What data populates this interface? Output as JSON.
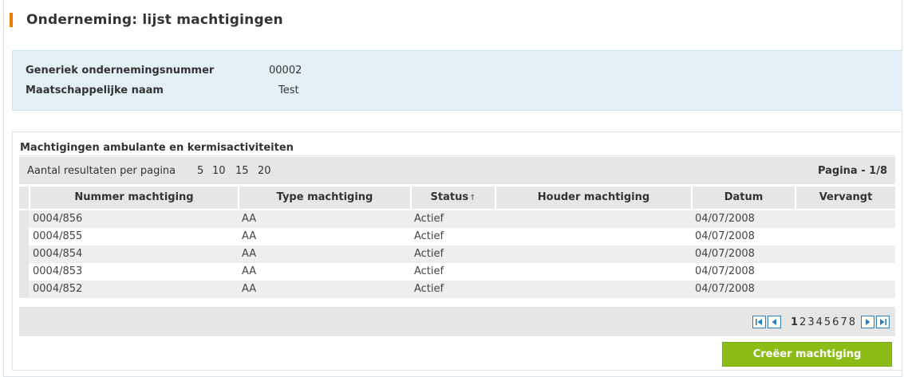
{
  "page": {
    "title": "Onderneming: lijst machtigingen"
  },
  "company": {
    "number_label": "Generiek ondernemingsnummer",
    "number_value": "00002",
    "name_label": "Maatschappelijke naam",
    "name_value": "Test"
  },
  "list": {
    "section_title": "Machtigingen ambulante en kermisactiviteiten",
    "per_page_label": "Aantal resultaten per pagina",
    "per_page_options": [
      "5",
      "10",
      "15",
      "20"
    ],
    "page_indicator": "Pagina - 1/8",
    "columns": {
      "nummer": "Nummer machtiging",
      "type": "Type machtiging",
      "status": "Status",
      "status_sort_icon": "↑",
      "houder": "Houder machtiging",
      "datum": "Datum",
      "vervangt": "Vervangt"
    },
    "rows": [
      {
        "nummer": "0004/856",
        "type": "AA",
        "status": "Actief",
        "houder": "",
        "datum": "04/07/2008",
        "vervangt": ""
      },
      {
        "nummer": "0004/855",
        "type": "AA",
        "status": "Actief",
        "houder": "",
        "datum": "04/07/2008",
        "vervangt": ""
      },
      {
        "nummer": "0004/854",
        "type": "AA",
        "status": "Actief",
        "houder": "",
        "datum": "04/07/2008",
        "vervangt": ""
      },
      {
        "nummer": "0004/853",
        "type": "AA",
        "status": "Actief",
        "houder": "",
        "datum": "04/07/2008",
        "vervangt": ""
      },
      {
        "nummer": "0004/852",
        "type": "AA",
        "status": "Actief",
        "houder": "",
        "datum": "04/07/2008",
        "vervangt": ""
      }
    ],
    "pager": {
      "first_icon": "first-page-icon",
      "prev_icon": "previous-page-icon",
      "next_icon": "next-page-icon",
      "last_icon": "last-page-icon",
      "pages": [
        "1",
        "2",
        "3",
        "4",
        "5",
        "6",
        "7",
        "8"
      ],
      "current": "1"
    }
  },
  "actions": {
    "create_label": "Creëer machtiging"
  },
  "colors": {
    "accent": "#f07d00",
    "info_bg": "#e3f1f7",
    "button_green": "#8cbd16",
    "pager_blue": "#2a7fc1"
  }
}
